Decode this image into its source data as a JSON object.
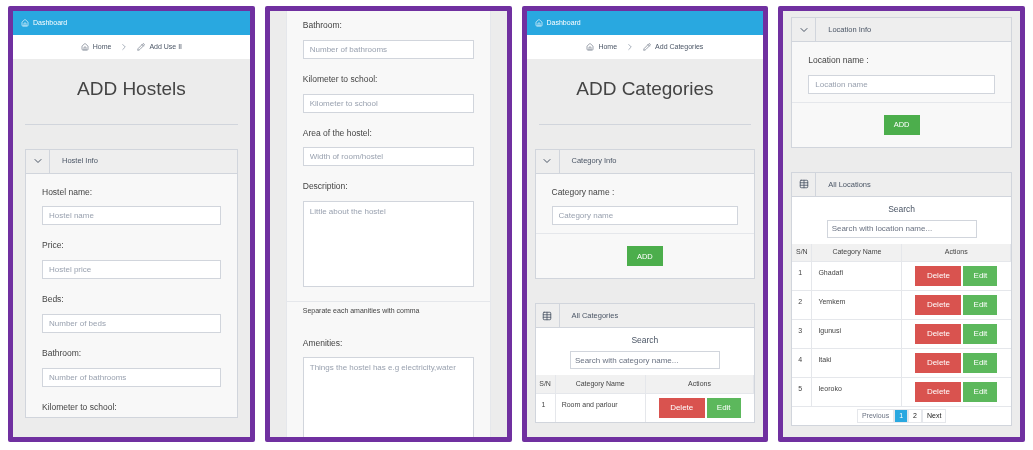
{
  "screens": [
    {
      "nav": {
        "label": "Dashboard"
      },
      "breadcrumb": [
        {
          "kind": "home",
          "label": "Home"
        },
        {
          "kind": "edit",
          "label": "Add Use II"
        }
      ],
      "title": "ADD Hostels",
      "section": {
        "title": "Hostel Info",
        "expanded": true,
        "fields": [
          {
            "kind": "input",
            "label": "Hostel name:",
            "placeholder": "Hostel name"
          },
          {
            "kind": "input",
            "label": "Price:",
            "placeholder": "Hostel price"
          },
          {
            "kind": "input",
            "label": "Beds:",
            "placeholder": "Number of beds"
          },
          {
            "kind": "input",
            "label": "Bathroom:",
            "placeholder": "Number of bathrooms"
          },
          {
            "kind": "label",
            "label": "Kilometer to school:"
          }
        ]
      }
    },
    {
      "fields": [
        {
          "kind": "input",
          "label": "Bathroom:",
          "placeholder": "Number of bathrooms"
        },
        {
          "kind": "input",
          "label": "Kilometer to school:",
          "placeholder": "Kilometer to school"
        },
        {
          "kind": "input",
          "label": "Area of the hostel:",
          "placeholder": "Width of room/hostel"
        },
        {
          "kind": "textarea",
          "label": "Description:",
          "placeholder": "Little about the hostel"
        },
        {
          "kind": "note",
          "label": "Separate each amanities with comma"
        },
        {
          "kind": "textarea",
          "label": "Amenities:",
          "placeholder": "Things the hostel has e.g electricity,water"
        }
      ]
    },
    {
      "nav": {
        "label": "Dashboard"
      },
      "breadcrumb": [
        {
          "kind": "home",
          "label": "Home"
        },
        {
          "kind": "edit",
          "label": "Add Categories"
        }
      ],
      "title": "ADD Categories",
      "form": {
        "title": "Category Info",
        "expanded": true,
        "label": "Category name :",
        "placeholder": "Category name",
        "button": "ADD"
      },
      "list": {
        "title": "All Categories",
        "search_label": "Search",
        "search_placeholder": "Search with category name...",
        "columns": [
          "S/N",
          "Category Name",
          "Actions"
        ],
        "rows": [
          {
            "sn": "1",
            "name": "Room and parlour",
            "actions": [
              "Delete",
              "Edit"
            ]
          }
        ]
      }
    },
    {
      "form": {
        "title": "Location Info",
        "expanded": true,
        "label": "Location name :",
        "placeholder": "Location name",
        "button": "ADD"
      },
      "list": {
        "title": "All Locations",
        "search_label": "Search",
        "search_placeholder": "Search with location name...",
        "columns": [
          "S/N",
          "Category Name",
          "Actions"
        ],
        "rows": [
          {
            "sn": "1",
            "name": "Ghadafi",
            "actions": [
              "Delete",
              "Edit"
            ]
          },
          {
            "sn": "2",
            "name": "Yemkem",
            "actions": [
              "Delete",
              "Edit"
            ]
          },
          {
            "sn": "3",
            "name": "Igunusi",
            "actions": [
              "Delete",
              "Edit"
            ]
          },
          {
            "sn": "4",
            "name": "Itaki",
            "actions": [
              "Delete",
              "Edit"
            ]
          },
          {
            "sn": "5",
            "name": "Ieoroko",
            "actions": [
              "Delete",
              "Edit"
            ]
          }
        ],
        "pagination": [
          {
            "label": "Previous",
            "disabled": true,
            "selected": false
          },
          {
            "label": "1",
            "disabled": false,
            "selected": true
          },
          {
            "label": "2",
            "disabled": false,
            "selected": false
          },
          {
            "label": "Next",
            "disabled": false,
            "selected": false
          }
        ]
      }
    }
  ]
}
